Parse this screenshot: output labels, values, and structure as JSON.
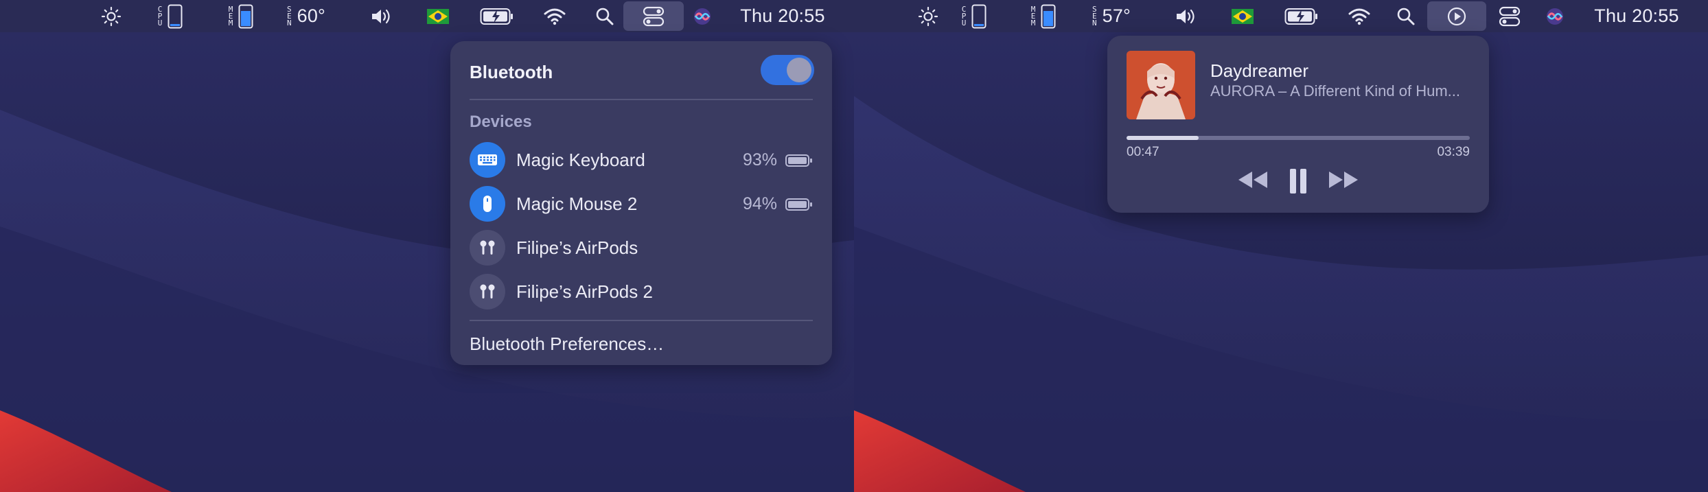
{
  "left_menubar": {
    "temperature": "60°",
    "clock": "Thu 20:55",
    "cpu_label": "CPU",
    "mem_label": "MEM",
    "sen_label": "SEN"
  },
  "right_menubar": {
    "temperature": "57°",
    "clock": "Thu 20:55",
    "cpu_label": "CPU",
    "mem_label": "MEM",
    "sen_label": "SEN"
  },
  "bluetooth_panel": {
    "title": "Bluetooth",
    "enabled": true,
    "devices_heading": "Devices",
    "devices": [
      {
        "name": "Magic Keyboard",
        "battery": "93%",
        "icon": "keyboard-icon",
        "connected": true
      },
      {
        "name": "Magic Mouse 2",
        "battery": "94%",
        "icon": "mouse-icon",
        "connected": true
      },
      {
        "name": "Filipe’s AirPods",
        "battery": "",
        "icon": "airpods-icon",
        "connected": false
      },
      {
        "name": "Filipe’s AirPods 2",
        "battery": "",
        "icon": "airpods-icon",
        "connected": false
      }
    ],
    "preferences_label": "Bluetooth Preferences…"
  },
  "now_playing": {
    "title": "Daydreamer",
    "subtitle": "AURORA – A Different Kind of Hum...",
    "elapsed": "00:47",
    "duration": "03:39",
    "progress_fraction": 0.21
  },
  "colors": {
    "accent": "#2a7be8",
    "toggle_on": "#3271e0",
    "menubar": "#2a2b55",
    "popover": "#3a3b61"
  }
}
